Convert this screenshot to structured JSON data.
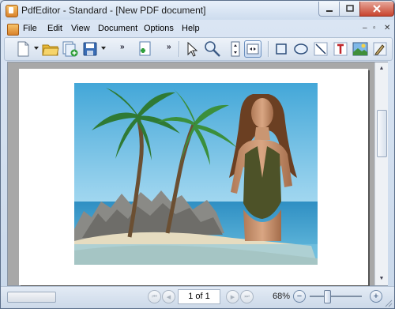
{
  "window": {
    "title": "PdfEditor - Standard - [New PDF document]"
  },
  "menu": {
    "items": [
      "File",
      "Edit",
      "View",
      "Document",
      "Options",
      "Help"
    ]
  },
  "toolbar": {
    "tools": [
      "new-document",
      "open-folder",
      "add-pages",
      "save",
      "insert-page",
      "select-arrow",
      "zoom-area",
      "fit-height",
      "fit-width",
      "rectangle",
      "ellipse",
      "line",
      "text",
      "image",
      "pen"
    ],
    "active_tool": "fit-width"
  },
  "document": {
    "image": "tropical beach photo with palm trees, rocks and a woman in a green swimsuit"
  },
  "status": {
    "page_indicator": "1 of 1",
    "zoom_level": "68%",
    "zoom_slider_fraction": 0.32
  },
  "colors": {
    "accent": "#6a8fbf",
    "close_button": "#c8442e"
  }
}
